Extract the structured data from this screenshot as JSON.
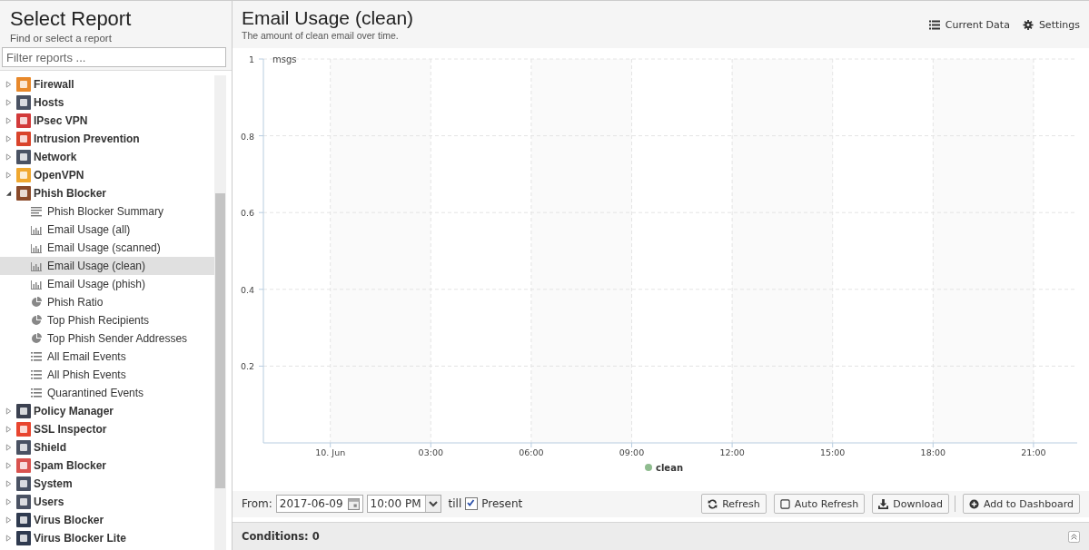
{
  "sidebar": {
    "title": "Select Report",
    "subtitle": "Find or select a report",
    "filter": {
      "placeholder": "Filter reports ..."
    },
    "tree": [
      {
        "label": "Firewall",
        "color": "#e8892b",
        "expanded": false
      },
      {
        "label": "Hosts",
        "color": "#4a5263",
        "expanded": false
      },
      {
        "label": "IPsec VPN",
        "color": "#d23a3a",
        "expanded": false
      },
      {
        "label": "Intrusion Prevention",
        "color": "#d9442b",
        "expanded": false
      },
      {
        "label": "Network",
        "color": "#4a5263",
        "expanded": false
      },
      {
        "label": "OpenVPN",
        "color": "#f0a830",
        "expanded": false
      },
      {
        "label": "Phish Blocker",
        "color": "#8a4a2a",
        "expanded": true,
        "children": [
          {
            "label": "Phish Blocker Summary",
            "kind": "summary",
            "selected": false
          },
          {
            "label": "Email Usage (all)",
            "kind": "bar",
            "selected": false
          },
          {
            "label": "Email Usage (scanned)",
            "kind": "bar",
            "selected": false
          },
          {
            "label": "Email Usage (clean)",
            "kind": "bar",
            "selected": true
          },
          {
            "label": "Email Usage (phish)",
            "kind": "bar",
            "selected": false
          },
          {
            "label": "Phish Ratio",
            "kind": "pie",
            "selected": false
          },
          {
            "label": "Top Phish Recipients",
            "kind": "pie",
            "selected": false
          },
          {
            "label": "Top Phish Sender Addresses",
            "kind": "pie",
            "selected": false
          },
          {
            "label": "All Email Events",
            "kind": "list",
            "selected": false
          },
          {
            "label": "All Phish Events",
            "kind": "list",
            "selected": false
          },
          {
            "label": "Quarantined Events",
            "kind": "list",
            "selected": false
          }
        ]
      },
      {
        "label": "Policy Manager",
        "color": "#3b4150",
        "expanded": false
      },
      {
        "label": "SSL Inspector",
        "color": "#e8452f",
        "expanded": false
      },
      {
        "label": "Shield",
        "color": "#4a5263",
        "expanded": false
      },
      {
        "label": "Spam Blocker",
        "color": "#d9534f",
        "expanded": false
      },
      {
        "label": "System",
        "color": "#4a5263",
        "expanded": false
      },
      {
        "label": "Users",
        "color": "#4a5263",
        "expanded": false
      },
      {
        "label": "Virus Blocker",
        "color": "#2f3a4f",
        "expanded": false
      },
      {
        "label": "Virus Blocker Lite",
        "color": "#2f3a4f",
        "expanded": false
      }
    ]
  },
  "report": {
    "title": "Email Usage (clean)",
    "description": "The amount of clean email over time.",
    "links": [
      "Current Data",
      "Settings"
    ],
    "chart_data": {
      "type": "line",
      "ylabel": "msgs",
      "ylim": [
        0,
        1
      ],
      "grid": true,
      "yticks": [
        0.2,
        0.4,
        0.6,
        0.8,
        1
      ],
      "categories": [
        "10. Jun",
        "03:00",
        "06:00",
        "09:00",
        "12:00",
        "15:00",
        "18:00",
        "21:00"
      ],
      "series": [
        {
          "name": "clean",
          "color": "#8fbc8f",
          "values": [
            null,
            null,
            null,
            null,
            null,
            null,
            null,
            null
          ]
        }
      ]
    }
  },
  "toolbar": {
    "from_label": "From:",
    "date": "2017-06-09",
    "time": "10:00 PM",
    "till_label": "till",
    "present": {
      "label": "Present",
      "checked": true
    },
    "refresh": "Refresh",
    "auto_refresh": {
      "label": "Auto Refresh",
      "on": false
    },
    "download": "Download",
    "add": "Add to Dashboard"
  },
  "conditions": "Conditions: 0"
}
